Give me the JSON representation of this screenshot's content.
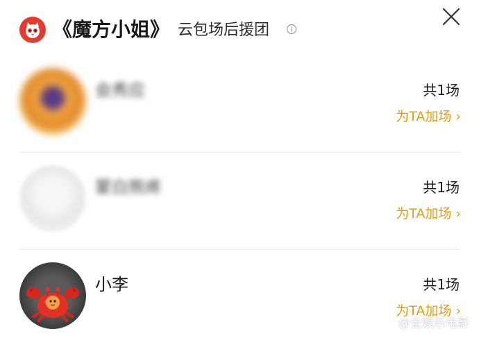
{
  "header": {
    "title": "《魔方小姐》",
    "subtitle": "云包场后援团",
    "logo_icon": "cat-eye-logo",
    "info_icon": "info-icon",
    "close_icon": "close-icon",
    "logo_color": "#e53a2f"
  },
  "supporters": [
    {
      "name": "会秀应",
      "count": "共1场",
      "action": "为TA加场 ›",
      "avatar_style": "blurred-warm"
    },
    {
      "name": "蒙白熊疼",
      "count": "共1场",
      "action": "为TA加场 ›",
      "avatar_style": "blurred-default"
    },
    {
      "name": "小李",
      "count": "共1场",
      "action": "为TA加场 ›",
      "avatar_style": "crab-toy"
    }
  ],
  "watermark": "@全娱乐电影",
  "accent_color": "#e79c12"
}
